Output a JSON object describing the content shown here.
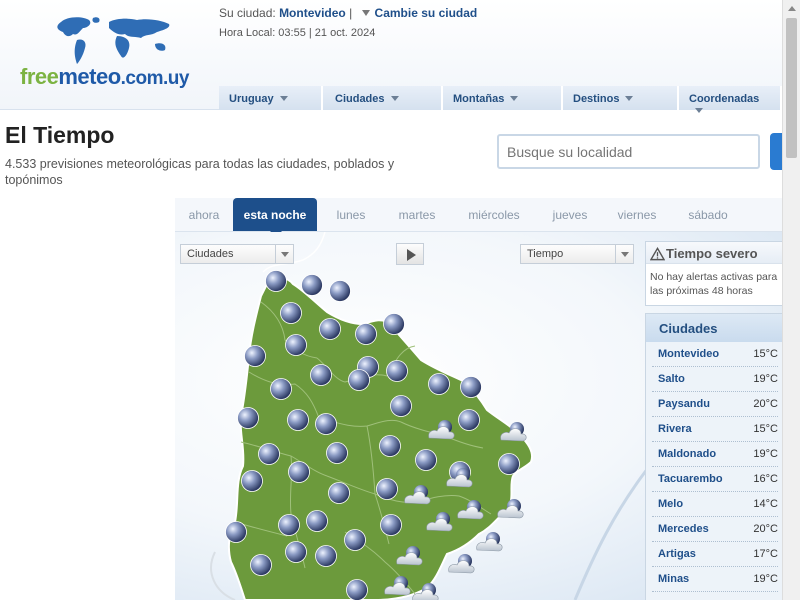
{
  "header": {
    "logo": {
      "part1": "free",
      "part2": "meteo",
      "part3": ".com.uy"
    },
    "city_label": "Su ciudad:",
    "city_name": "Montevideo",
    "separator": "|",
    "change_city": "Cambie su ciudad",
    "local_time": "Hora Local: 03:55 | 21 oct. 2024"
  },
  "nav": [
    {
      "label": "Uruguay"
    },
    {
      "label": "Ciudades"
    },
    {
      "label": "Montañas"
    },
    {
      "label": "Destinos"
    },
    {
      "label": "Coordenadas"
    }
  ],
  "page": {
    "title": "El Tiempo",
    "subtitle": "4.533 previsiones meteorológicas para todas las ciudades, poblados y topónimos",
    "search_placeholder": "Busque su localidad"
  },
  "tabs": [
    {
      "label": "ahora"
    },
    {
      "label": "esta noche",
      "active": true
    },
    {
      "label": "lunes"
    },
    {
      "label": "martes"
    },
    {
      "label": "miércoles"
    },
    {
      "label": "jueves"
    },
    {
      "label": "viernes"
    },
    {
      "label": "sábado"
    }
  ],
  "map_controls": {
    "layer_select": "Ciudades",
    "type_select": "Tiempo"
  },
  "severe_weather": {
    "title": "Tiempo severo",
    "text": "No hay alertas activas para las próximas 48 horas"
  },
  "cities_panel": {
    "title": "Ciudades",
    "rows": [
      {
        "name": "Montevideo",
        "temp": "15°C"
      },
      {
        "name": "Salto",
        "temp": "19°C"
      },
      {
        "name": "Paysandu",
        "temp": "20°C"
      },
      {
        "name": "Rivera",
        "temp": "15°C"
      },
      {
        "name": "Maldonado",
        "temp": "19°C"
      },
      {
        "name": "Tacuarembo",
        "temp": "16°C"
      },
      {
        "name": "Melo",
        "temp": "14°C"
      },
      {
        "name": "Mercedes",
        "temp": "20°C"
      },
      {
        "name": "Artigas",
        "temp": "17°C"
      },
      {
        "name": "Minas",
        "temp": "19°C"
      }
    ]
  },
  "colors": {
    "brand_blue": "#1f5aa8",
    "brand_green": "#7cb342",
    "map_land": "#6c9a3c",
    "active_tab": "#1d4f8b"
  },
  "icons": {
    "night_clear": "moon-icon",
    "night_cloudy": "cloud-moon-icon",
    "warning": "warning-icon"
  }
}
